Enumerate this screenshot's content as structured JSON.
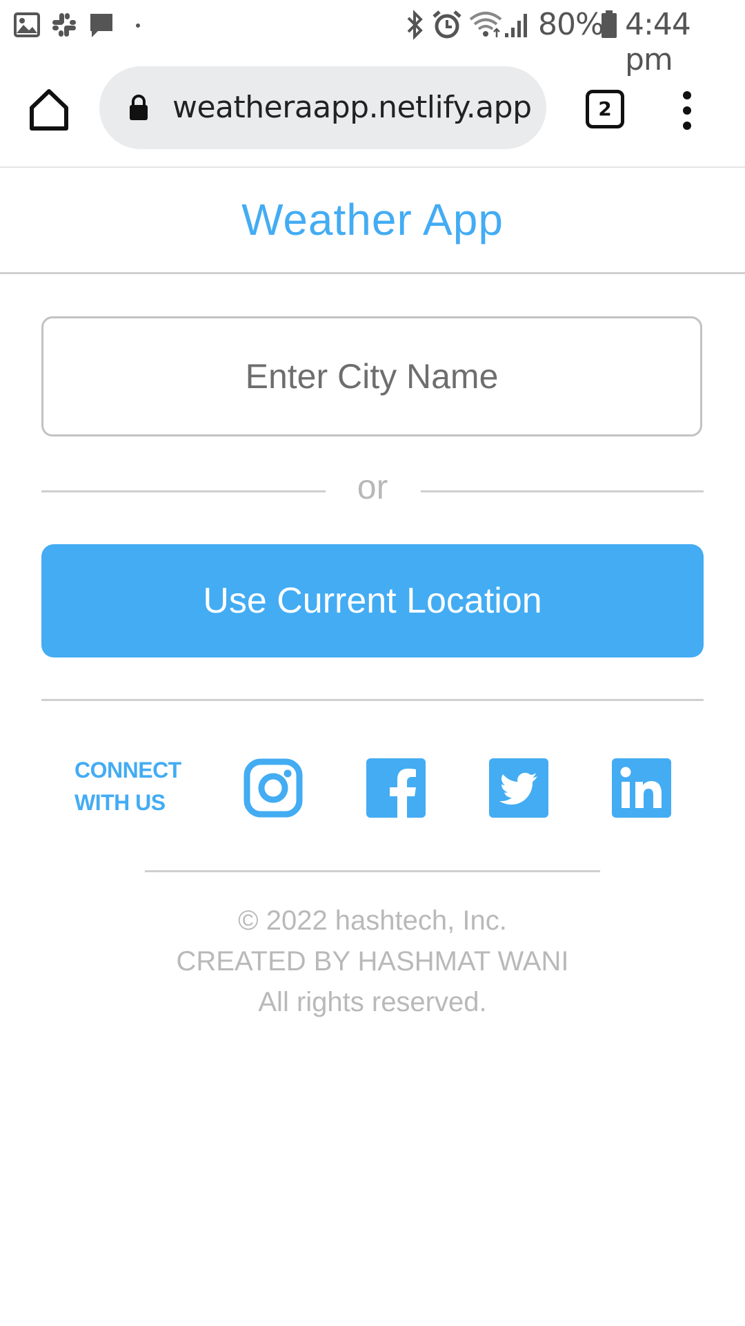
{
  "status_bar": {
    "left_icons": [
      "image-icon",
      "slack-icon",
      "message-icon",
      "dot-icon"
    ],
    "right_icons": [
      "bluetooth-icon",
      "alarm-icon",
      "wifi-icon",
      "signal-icon",
      "battery-icon"
    ],
    "battery": "80%",
    "time": "4:44 pm"
  },
  "browser": {
    "url": "weatheraapp.netlify.app",
    "tab_count": "2"
  },
  "app": {
    "title": "Weather App"
  },
  "form": {
    "city_placeholder": "Enter City Name",
    "city_value": "",
    "or_label": "or",
    "location_button": "Use Current Location"
  },
  "connect": {
    "label_line1": "CONNECT",
    "label_line2": "WITH US",
    "icons": [
      "instagram-icon",
      "facebook-icon",
      "twitter-icon",
      "linkedin-icon"
    ]
  },
  "footer": {
    "line1": "© 2022 hashtech, Inc.",
    "line2": "CREATED BY HASHMAT WANI",
    "line3": "All rights reserved."
  },
  "colors": {
    "accent": "#43acf3",
    "muted_text": "#b9b9b9",
    "divider": "#cfcfcf"
  }
}
